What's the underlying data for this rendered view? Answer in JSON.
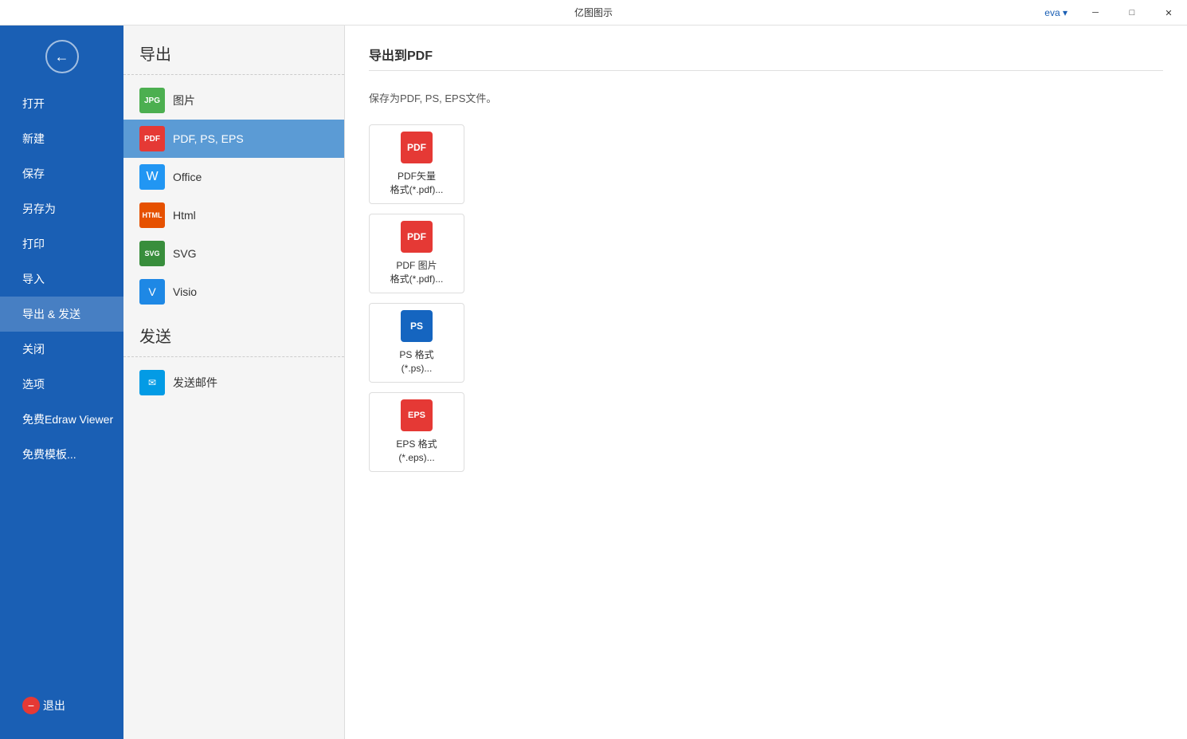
{
  "titlebar": {
    "title": "亿图图示",
    "user": "eva ▾",
    "minimize": "─",
    "maximize": "□",
    "close": "✕"
  },
  "sidebar": {
    "back_label": "←",
    "items": [
      {
        "id": "open",
        "label": "打开"
      },
      {
        "id": "new",
        "label": "新建"
      },
      {
        "id": "save",
        "label": "保存"
      },
      {
        "id": "saveas",
        "label": "另存为"
      },
      {
        "id": "print",
        "label": "打印"
      },
      {
        "id": "import",
        "label": "导入"
      },
      {
        "id": "export",
        "label": "导出 & 发送",
        "active": true
      },
      {
        "id": "close",
        "label": "关闭"
      },
      {
        "id": "options",
        "label": "选项"
      },
      {
        "id": "viewer",
        "label": "免费Edraw Viewer"
      },
      {
        "id": "templates",
        "label": "免费模板..."
      }
    ],
    "exit_label": "退出"
  },
  "left_panel": {
    "export_title": "导出",
    "export_items": [
      {
        "id": "image",
        "label": "图片",
        "icon_type": "jpg"
      },
      {
        "id": "pdf",
        "label": "PDF, PS, EPS",
        "icon_type": "pdf",
        "selected": true
      },
      {
        "id": "office",
        "label": "Office",
        "icon_type": "word"
      },
      {
        "id": "html",
        "label": "Html",
        "icon_type": "html"
      },
      {
        "id": "svg",
        "label": "SVG",
        "icon_type": "svg"
      },
      {
        "id": "visio",
        "label": "Visio",
        "icon_type": "visio"
      }
    ],
    "send_title": "发送",
    "send_items": [
      {
        "id": "email",
        "label": "发送邮件",
        "icon_type": "email"
      }
    ]
  },
  "right_panel": {
    "title": "导出到PDF",
    "description": "保存为PDF, PS, EPS文件。",
    "formats": [
      {
        "id": "pdf_vector",
        "label": "PDF矢量\n格式(*.pdf)...",
        "icon_type": "pdf_red",
        "icon_text": "PDF"
      },
      {
        "id": "pdf_image",
        "label": "PDF 图片\n格式(*.pdf)...",
        "icon_type": "pdf_red",
        "icon_text": "PDF"
      },
      {
        "id": "ps",
        "label": "PS 格式\n(*.ps)...",
        "icon_type": "ps",
        "icon_text": "PS"
      },
      {
        "id": "eps",
        "label": "EPS 格式\n(*.eps)...",
        "icon_type": "eps",
        "icon_text": "EPS"
      }
    ]
  }
}
